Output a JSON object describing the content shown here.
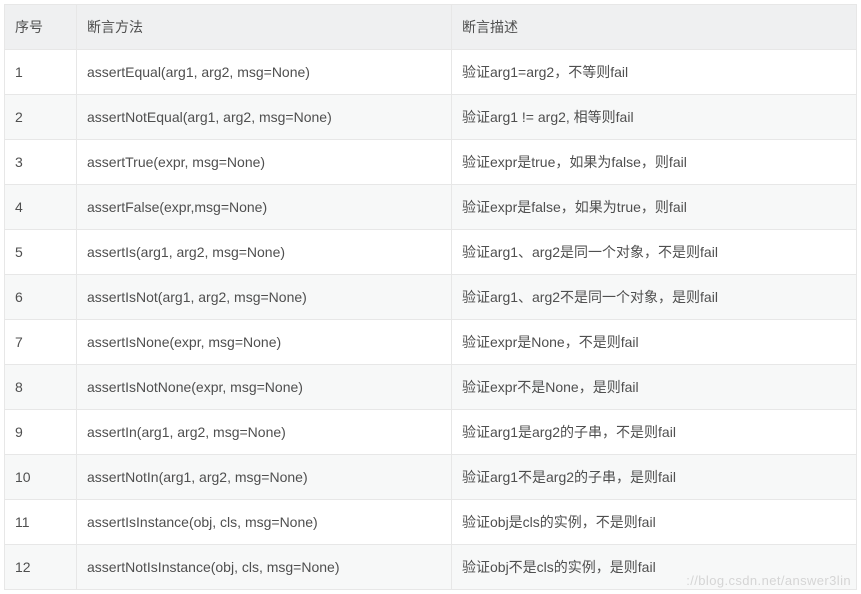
{
  "headers": {
    "no": "序号",
    "method": "断言方法",
    "desc": "断言描述"
  },
  "rows": [
    {
      "no": "1",
      "method": "assertEqual(arg1, arg2, msg=None)",
      "desc": "验证arg1=arg2，不等则fail"
    },
    {
      "no": "2",
      "method": "assertNotEqual(arg1, arg2, msg=None)",
      "desc": "验证arg1 != arg2, 相等则fail"
    },
    {
      "no": "3",
      "method": "assertTrue(expr, msg=None)",
      "desc": "验证expr是true，如果为false，则fail"
    },
    {
      "no": "4",
      "method": "assertFalse(expr,msg=None)",
      "desc": "验证expr是false，如果为true，则fail"
    },
    {
      "no": "5",
      "method": "assertIs(arg1, arg2, msg=None)",
      "desc": "验证arg1、arg2是同一个对象，不是则fail"
    },
    {
      "no": "6",
      "method": "assertIsNot(arg1, arg2, msg=None)",
      "desc": "验证arg1、arg2不是同一个对象，是则fail"
    },
    {
      "no": "7",
      "method": "assertIsNone(expr, msg=None)",
      "desc": "验证expr是None，不是则fail"
    },
    {
      "no": "8",
      "method": "assertIsNotNone(expr, msg=None)",
      "desc": "验证expr不是None，是则fail"
    },
    {
      "no": "9",
      "method": "assertIn(arg1, arg2, msg=None)",
      "desc": "验证arg1是arg2的子串，不是则fail"
    },
    {
      "no": "10",
      "method": "assertNotIn(arg1, arg2, msg=None)",
      "desc": "验证arg1不是arg2的子串，是则fail"
    },
    {
      "no": "11",
      "method": "assertIsInstance(obj, cls, msg=None)",
      "desc": "验证obj是cls的实例，不是则fail"
    },
    {
      "no": "12",
      "method": "assertNotIsInstance(obj, cls, msg=None)",
      "desc": "验证obj不是cls的实例，是则fail"
    }
  ],
  "watermark": "://blog.csdn.net/answer3lin"
}
